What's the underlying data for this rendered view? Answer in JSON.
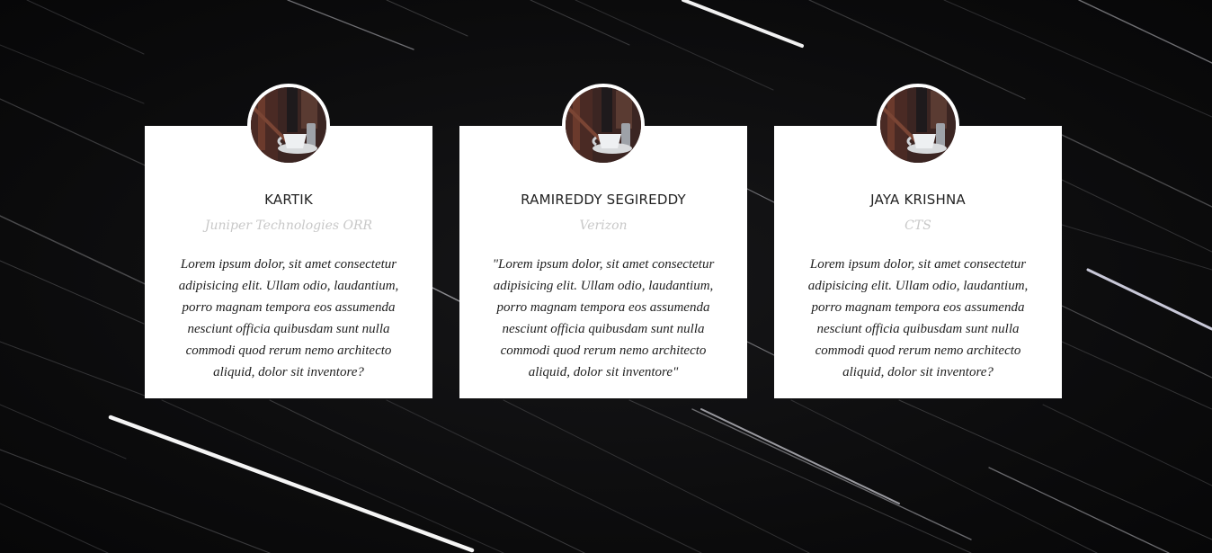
{
  "testimonials": [
    {
      "name": "KARTIK",
      "company": "Juniper Technologies ORR",
      "quote": "Lorem ipsum dolor, sit amet consectetur adipisicing elit. Ullam odio, laudantium, porro magnam tempora eos assumenda nesciunt officia quibusdam sunt nulla commodi quod rerum nemo architecto aliquid, dolor sit inventore?",
      "avatar_icon": "coffee-cup-photo"
    },
    {
      "name": "RAMIREDDY SEGIREDDY",
      "company": "Verizon",
      "quote": "\"Lorem ipsum dolor, sit amet consectetur adipisicing elit. Ullam odio, laudantium, porro magnam tempora eos assumenda nesciunt officia quibusdam sunt nulla commodi quod rerum nemo architecto aliquid, dolor sit inventore\"",
      "avatar_icon": "coffee-cup-photo"
    },
    {
      "name": "JAYA KRISHNA",
      "company": "CTS",
      "quote": "Lorem ipsum dolor, sit amet consectetur adipisicing elit. Ullam odio, laudantium, porro magnam tempora eos assumenda nesciunt officia quibusdam sunt nulla commodi quod rerum nemo architecto aliquid, dolor sit inventore?",
      "avatar_icon": "coffee-cup-photo"
    }
  ],
  "colors": {
    "background": "#0d0d0e",
    "card": "#ffffff",
    "name": "#222222",
    "company": "#c8c8c8",
    "quote": "#1e1e1e"
  }
}
